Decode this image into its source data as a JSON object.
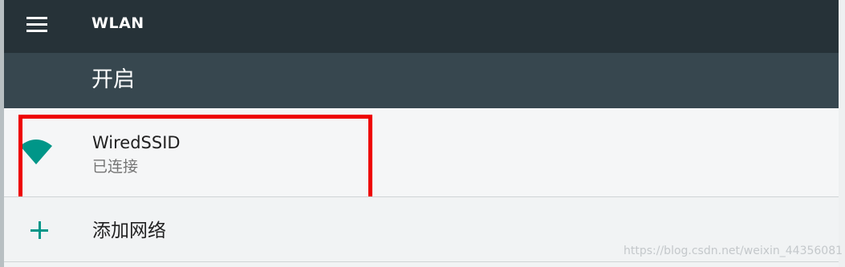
{
  "toolbar": {
    "menu_icon": "hamburger-menu-icon",
    "title": "WLAN",
    "background": "#263238"
  },
  "switch_bar": {
    "label": "开启",
    "background": "#37474f"
  },
  "networks": [
    {
      "name": "WiredSSID",
      "status": "已连接",
      "icon": "wifi-signal-icon",
      "icon_color": "#009688"
    }
  ],
  "add_network": {
    "icon": "plus-icon",
    "label": "添加网络",
    "icon_color": "#009688"
  },
  "annotation": {
    "highlight_color": "#ee0000"
  },
  "watermark": "https://blog.csdn.net/weixin_44356081"
}
